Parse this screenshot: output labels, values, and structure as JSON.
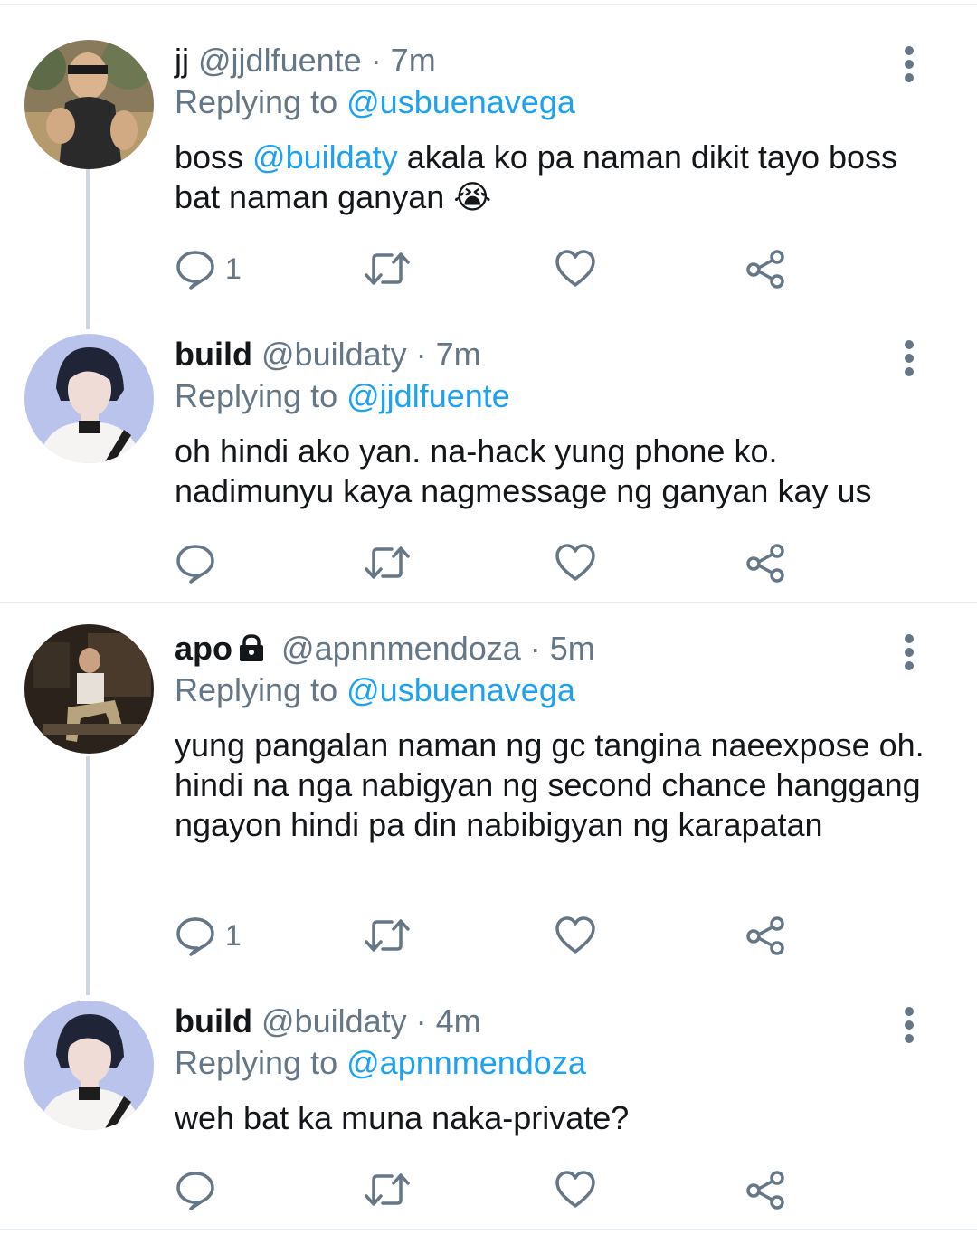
{
  "colors": {
    "accent": "#1da1f2",
    "muted": "#657786",
    "divider": "#e6ecf0",
    "thread": "#ccd6dd"
  },
  "tweets": [
    {
      "name": "jj",
      "handle": "@jjdlfuente",
      "time": "· 7m",
      "reply_prefix": "Replying to",
      "reply_to": "@usbuenavega",
      "body_parts": [
        "boss ",
        "@buildaty",
        " akala ko pa naman dikit tayo boss bat naman ganyan 😭"
      ],
      "reply_count": "1"
    },
    {
      "name": "build",
      "handle": "@buildaty",
      "time": "· 7m",
      "reply_prefix": "Replying to",
      "reply_to": "@jjdlfuente",
      "body": "oh hindi ako yan. na-hack yung phone ko. nadimunyu kaya nagmessage ng ganyan kay us",
      "reply_count": ""
    },
    {
      "name": "apo",
      "handle": "@apnnmendoza",
      "time": "· 5m",
      "reply_prefix": "Replying to",
      "reply_to": "@usbuenavega",
      "body": "yung pangalan naman ng gc tangina naeexpose oh. hindi na nga nabigyan ng second chance hanggang ngayon hindi pa din nabibigyan ng karapatan",
      "reply_count": "1"
    },
    {
      "name": "build",
      "handle": "@buildaty",
      "time": "· 4m",
      "reply_prefix": "Replying to",
      "reply_to": "@apnnmendoza",
      "body": "weh bat ka muna naka-private?",
      "reply_count": ""
    }
  ]
}
